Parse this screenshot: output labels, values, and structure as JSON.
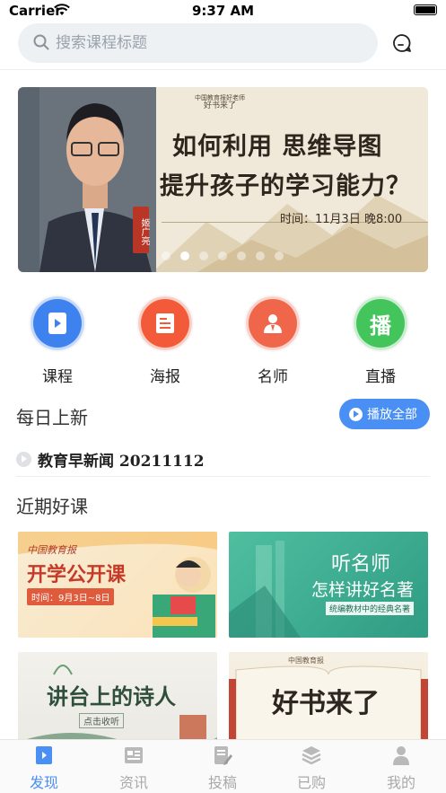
{
  "status_bar": {
    "carrier": "Carrier",
    "time": "9:37 AM"
  },
  "search": {
    "placeholder": "搜索课程标题"
  },
  "banner": {
    "tag_line1": "中国教育报好老师",
    "tag_line2": "好书来了",
    "title_line1": "如何利用 思维导图",
    "title_line2": "提升孩子的学习能力？",
    "time_text": "时间：11月3日  晚8:00",
    "speaker_seal": "姬广亮",
    "active_dot": 1,
    "dot_count": 7
  },
  "categories": [
    {
      "label": "课程",
      "icon": "video-lesson-icon",
      "color": "#3d82ee"
    },
    {
      "label": "海报",
      "icon": "poster-icon",
      "color": "#f25a3a"
    },
    {
      "label": "名师",
      "icon": "teacher-icon",
      "color": "#f0664a"
    },
    {
      "label": "直播",
      "icon": "live-icon",
      "color": "#43c55c",
      "glyph": "播"
    }
  ],
  "daily": {
    "title": "每日上新",
    "play_all": "播放全部",
    "news_title": "教育早新闻 20211112"
  },
  "recent": {
    "title": "近期好课",
    "cards": [
      {
        "headline": "开学公开课",
        "tag": "中国教育报",
        "sub": "时间：9月3日~8日"
      },
      {
        "headline": "听名师",
        "headline2": "怎样讲好名著",
        "sub": "统编教材中的经典名著"
      },
      {
        "headline": "讲台上的诗人",
        "sub": "点击收听"
      },
      {
        "headline": "好书来了",
        "tag": "中国教育报"
      }
    ]
  },
  "tabbar": {
    "tabs": [
      {
        "label": "发现",
        "icon": "discover-icon",
        "active": true
      },
      {
        "label": "资讯",
        "icon": "news-icon",
        "active": false
      },
      {
        "label": "投稿",
        "icon": "submit-icon",
        "active": false
      },
      {
        "label": "已购",
        "icon": "purchased-icon",
        "active": false
      },
      {
        "label": "我的",
        "icon": "profile-icon",
        "active": false
      }
    ]
  },
  "colors": {
    "accent": "#4a8ff3",
    "inactive_tab": "#a9a9a9"
  }
}
